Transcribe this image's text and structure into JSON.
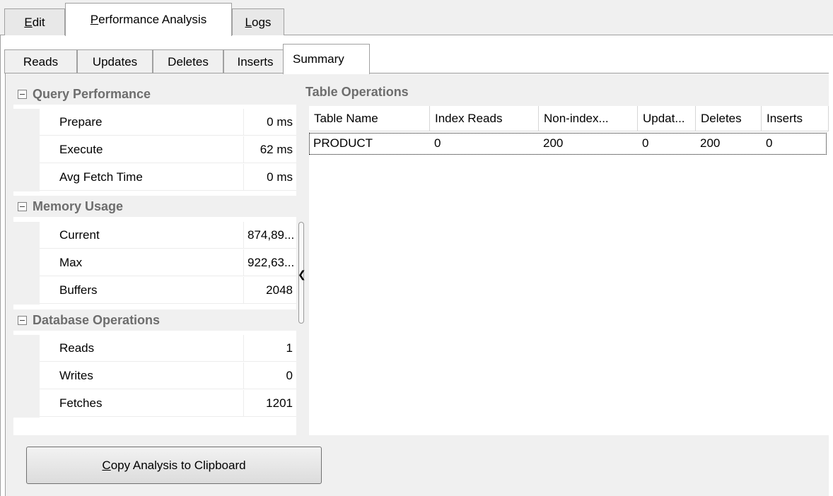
{
  "top_tabs": [
    {
      "accel": "E",
      "rest": "dit"
    },
    {
      "accel": "P",
      "rest": "erformance Analysis"
    },
    {
      "accel": "L",
      "rest": "ogs"
    }
  ],
  "sub_tabs": [
    "Reads",
    "Updates",
    "Deletes",
    "Inserts",
    "Summary"
  ],
  "groups": {
    "query": {
      "title": "Query Performance",
      "rows": [
        {
          "name": "Prepare",
          "value": "0 ms"
        },
        {
          "name": "Execute",
          "value": "62 ms"
        },
        {
          "name": "Avg Fetch Time",
          "value": "0 ms"
        }
      ]
    },
    "memory": {
      "title": "Memory Usage",
      "rows": [
        {
          "name": "Current",
          "value": "874,89..."
        },
        {
          "name": "Max",
          "value": "922,63..."
        },
        {
          "name": "Buffers",
          "value": "2048"
        }
      ]
    },
    "database": {
      "title": "Database Operations",
      "rows": [
        {
          "name": "Reads",
          "value": "1"
        },
        {
          "name": "Writes",
          "value": "0"
        },
        {
          "name": "Fetches",
          "value": "1201"
        }
      ]
    }
  },
  "table_operations": {
    "title": "Table Operations",
    "columns": [
      "Table Name",
      "Index Reads",
      "Non-index...",
      "Updat...",
      "Deletes",
      "Inserts"
    ],
    "rows": [
      [
        "PRODUCT",
        "0",
        "200",
        "0",
        "200",
        "0"
      ]
    ]
  },
  "button": {
    "accel": "C",
    "rest": "opy Analysis to Clipboard"
  },
  "icons": {
    "group_toggle": "collapse-minus-icon",
    "splitter": "chevron-left-icon"
  }
}
